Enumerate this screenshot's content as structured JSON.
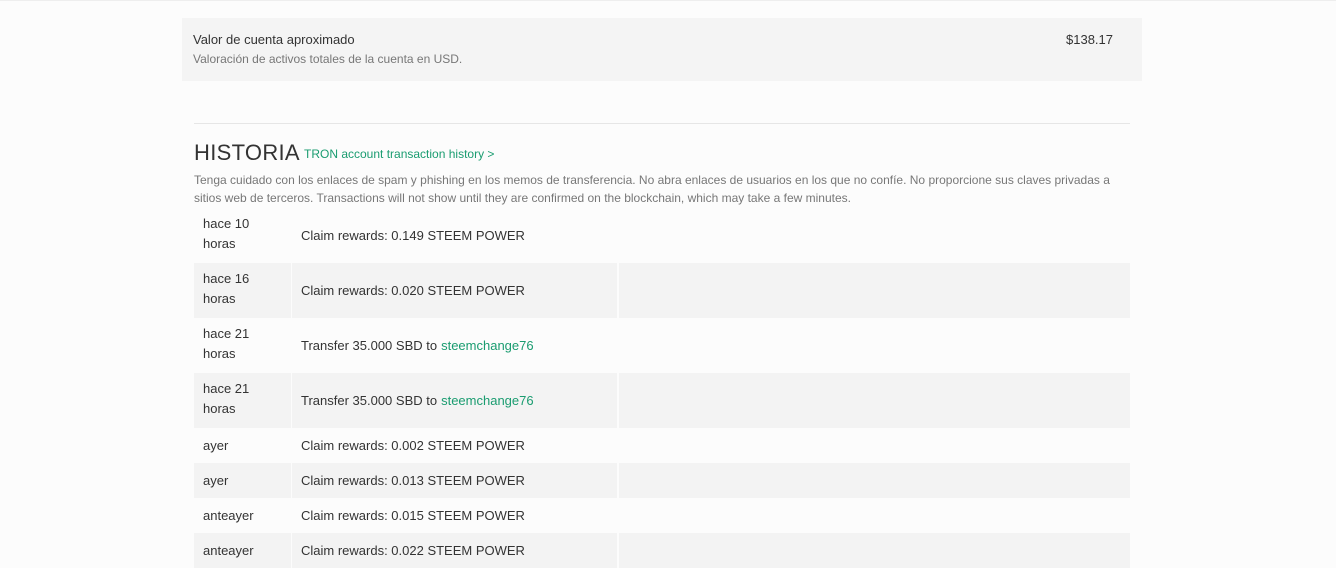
{
  "account_value": {
    "label": "Valor de cuenta aproximado",
    "description": "Valoración de activos totales de la cuenta en USD.",
    "amount": "$138.17"
  },
  "history": {
    "title": "HISTORIA",
    "tron_link": "TRON account transaction history >",
    "warning": "Tenga cuidado con los enlaces de spam y phishing en los memos de transferencia. No abra enlaces de usuarios en los que no confíe. No proporcione sus claves privadas a sitios web de terceros. Transactions will not show until they are confirmed on the blockchain, which may take a few minutes.",
    "rows": [
      {
        "time": "hace 10 horas",
        "op": "Claim rewards: 0.149 STEEM POWER",
        "user": ""
      },
      {
        "time": "hace 16 horas",
        "op": "Claim rewards: 0.020 STEEM POWER",
        "user": ""
      },
      {
        "time": "hace 21 horas",
        "op": "Transfer 35.000 SBD to",
        "user": "steemchange76"
      },
      {
        "time": "hace 21 horas",
        "op": "Transfer 35.000 SBD to",
        "user": "steemchange76"
      },
      {
        "time": "ayer",
        "op": "Claim rewards: 0.002 STEEM POWER",
        "user": ""
      },
      {
        "time": "ayer",
        "op": "Claim rewards: 0.013 STEEM POWER",
        "user": ""
      },
      {
        "time": "anteayer",
        "op": "Claim rewards: 0.015 STEEM POWER",
        "user": ""
      },
      {
        "time": "anteayer",
        "op": "Claim rewards: 0.022 STEEM POWER",
        "user": ""
      }
    ]
  },
  "colors": {
    "link": "#1a9c70",
    "row_alt": "#f3f3f3",
    "panel": "#f4f4f4"
  }
}
